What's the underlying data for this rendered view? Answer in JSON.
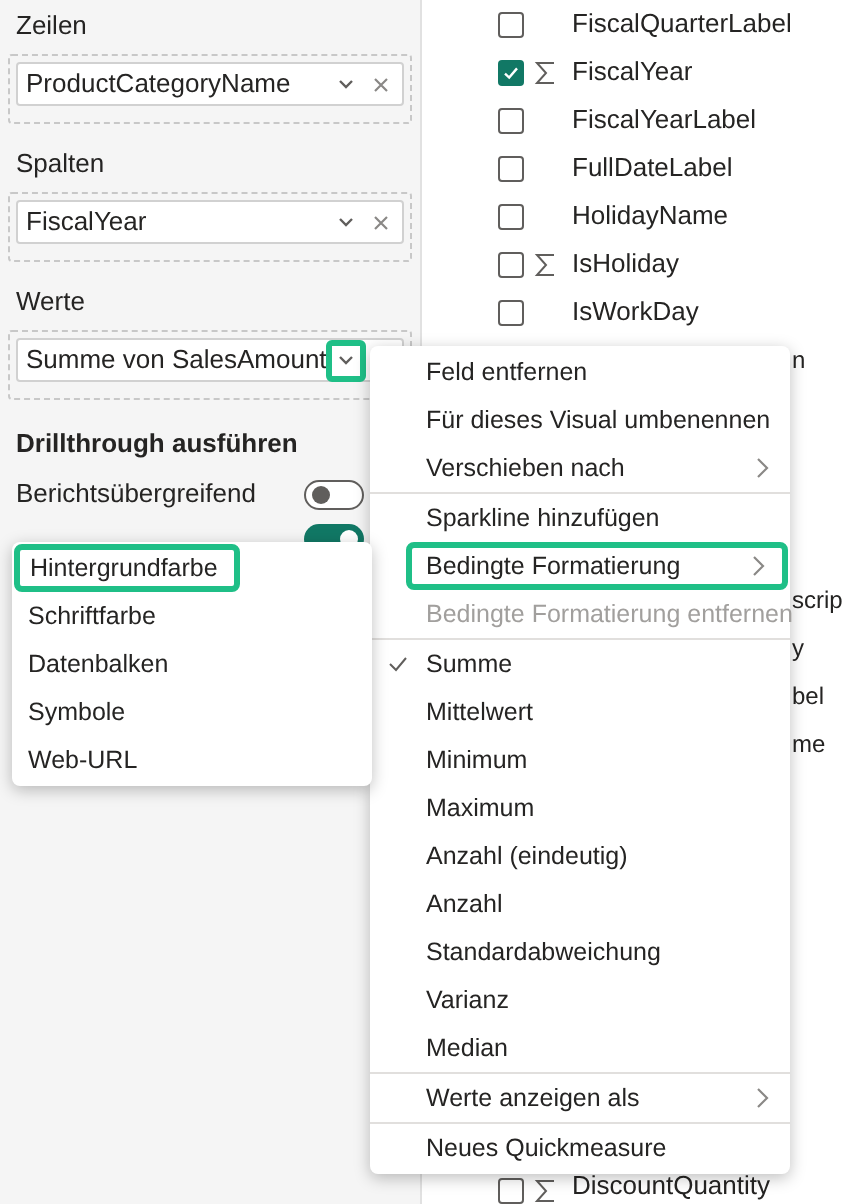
{
  "wells": [
    {
      "label": "Zeilen",
      "field": "ProductCategoryName",
      "chevron_highlighted": false
    },
    {
      "label": "Spalten",
      "field": "FiscalYear",
      "chevron_highlighted": false
    },
    {
      "label": "Werte",
      "field": "Summe von SalesAmount",
      "chevron_highlighted": true
    }
  ],
  "drillthrough": {
    "title": "Drillthrough ausführen",
    "toggles": [
      {
        "label": "Berichtsübergreifend",
        "on": false
      },
      {
        "on": true
      }
    ]
  },
  "fields": [
    {
      "label": "FiscalQuarterLabel",
      "checked": false,
      "sigma": false
    },
    {
      "label": "FiscalYear",
      "checked": true,
      "sigma": true
    },
    {
      "label": "FiscalYearLabel",
      "checked": false,
      "sigma": false
    },
    {
      "label": "FullDateLabel",
      "checked": false,
      "sigma": false
    },
    {
      "label": "HolidayName",
      "checked": false,
      "sigma": false
    },
    {
      "label": "IsHoliday",
      "checked": false,
      "sigma": true
    },
    {
      "label": "IsWorkDay",
      "checked": false,
      "sigma": false
    },
    {
      "label": "DiscountQuantity",
      "checked": false,
      "sigma": true
    }
  ],
  "fragments": [
    "n",
    "scrip",
    "y",
    "bel",
    "me"
  ],
  "context_menu": {
    "items": [
      {
        "kind": "item",
        "label": "Feld entfernen"
      },
      {
        "kind": "item",
        "label": "Für dieses Visual umbenennen"
      },
      {
        "kind": "item",
        "label": "Verschieben nach",
        "submenu": true
      },
      {
        "kind": "divider"
      },
      {
        "kind": "item",
        "label": "Sparkline hinzufügen"
      },
      {
        "kind": "item",
        "label": "Bedingte Formatierung",
        "submenu": true,
        "highlighted": true
      },
      {
        "kind": "item",
        "label": "Bedingte Formatierung entfernen",
        "disabled": true
      },
      {
        "kind": "divider"
      },
      {
        "kind": "item",
        "label": "Summe",
        "checked": true
      },
      {
        "kind": "item",
        "label": "Mittelwert",
        "checked": false
      },
      {
        "kind": "item",
        "label": "Minimum",
        "checked": false
      },
      {
        "kind": "item",
        "label": "Maximum",
        "checked": false
      },
      {
        "kind": "item",
        "label": "Anzahl (eindeutig)",
        "checked": false
      },
      {
        "kind": "item",
        "label": "Anzahl",
        "checked": false
      },
      {
        "kind": "item",
        "label": "Standardabweichung",
        "checked": false
      },
      {
        "kind": "item",
        "label": "Varianz",
        "checked": false
      },
      {
        "kind": "item",
        "label": "Median",
        "checked": false
      },
      {
        "kind": "divider"
      },
      {
        "kind": "item",
        "label": "Werte anzeigen als",
        "submenu": true
      },
      {
        "kind": "divider"
      },
      {
        "kind": "item",
        "label": "Neues Quickmeasure"
      }
    ]
  },
  "submenu": {
    "items": [
      {
        "label": "Hintergrundfarbe",
        "highlighted": true
      },
      {
        "label": "Schriftfarbe",
        "highlighted": false
      },
      {
        "label": "Datenbalken",
        "highlighted": false
      },
      {
        "label": "Symbole",
        "highlighted": false
      },
      {
        "label": "Web-URL",
        "highlighted": false
      }
    ]
  }
}
